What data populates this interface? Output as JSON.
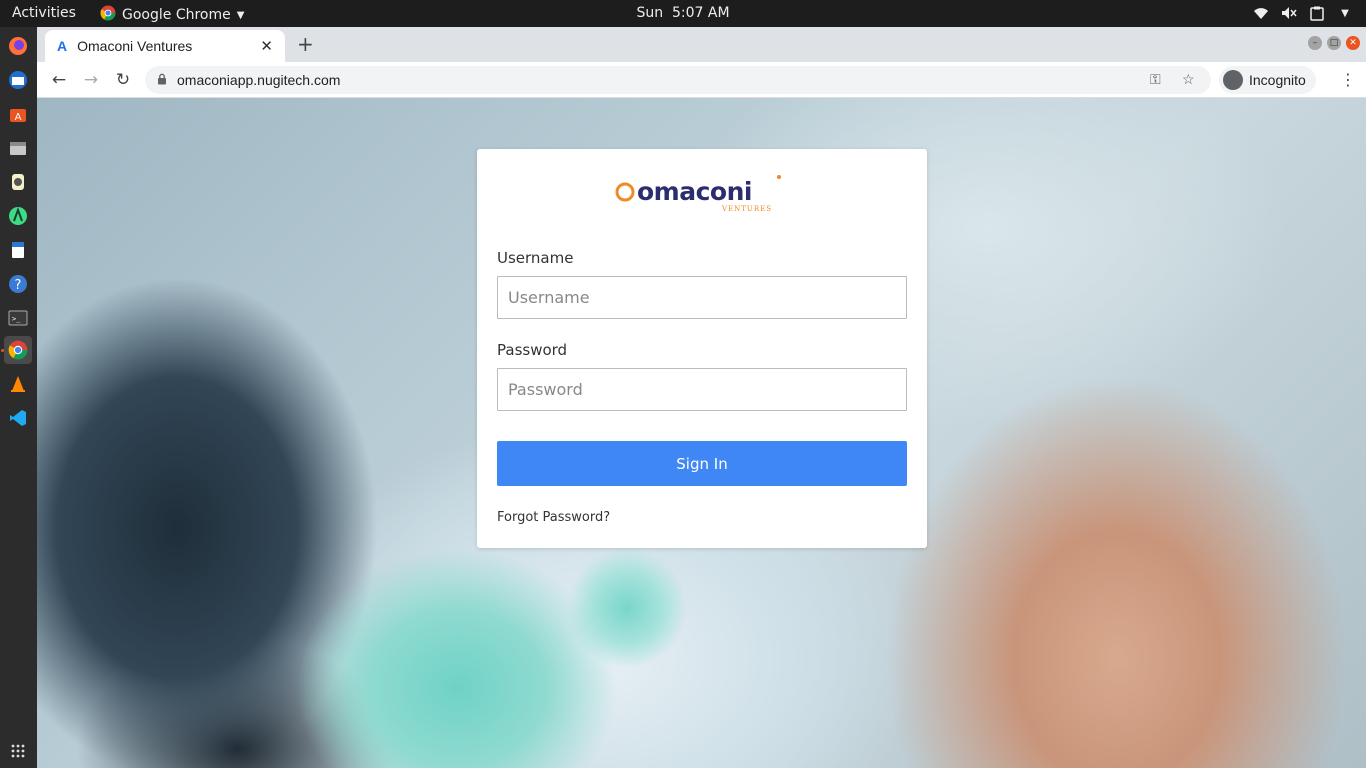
{
  "topbar": {
    "activities": "Activities",
    "app_name": "Google Chrome",
    "clock_day": "Sun",
    "clock_time": "5:07 AM"
  },
  "dock": {
    "items": [
      "firefox-icon",
      "thunderbird-icon",
      "software-center-icon",
      "files-icon",
      "media-icon",
      "android-studio-icon",
      "document-viewer-icon",
      "help-icon",
      "terminal-icon",
      "chrome-icon",
      "vlc-icon",
      "vscode-icon",
      "app-grid-icon"
    ]
  },
  "browser": {
    "tab_title": "Omaconi Ventures",
    "tab_favicon": "A",
    "url": "omaconiapp.nugitech.com",
    "incognito_label": "Incognito"
  },
  "login": {
    "logo_text": "omaconi",
    "logo_sub": "VENTURES",
    "username_label": "Username",
    "username_placeholder": "Username",
    "password_label": "Password",
    "password_placeholder": "Password",
    "signin_label": "Sign In",
    "forgot_label": "Forgot Password?"
  },
  "colors": {
    "accent": "#3f87f5",
    "logo_orange": "#f08a24",
    "logo_navy": "#2b2d6e",
    "ubuntu_orange": "#e95420"
  }
}
